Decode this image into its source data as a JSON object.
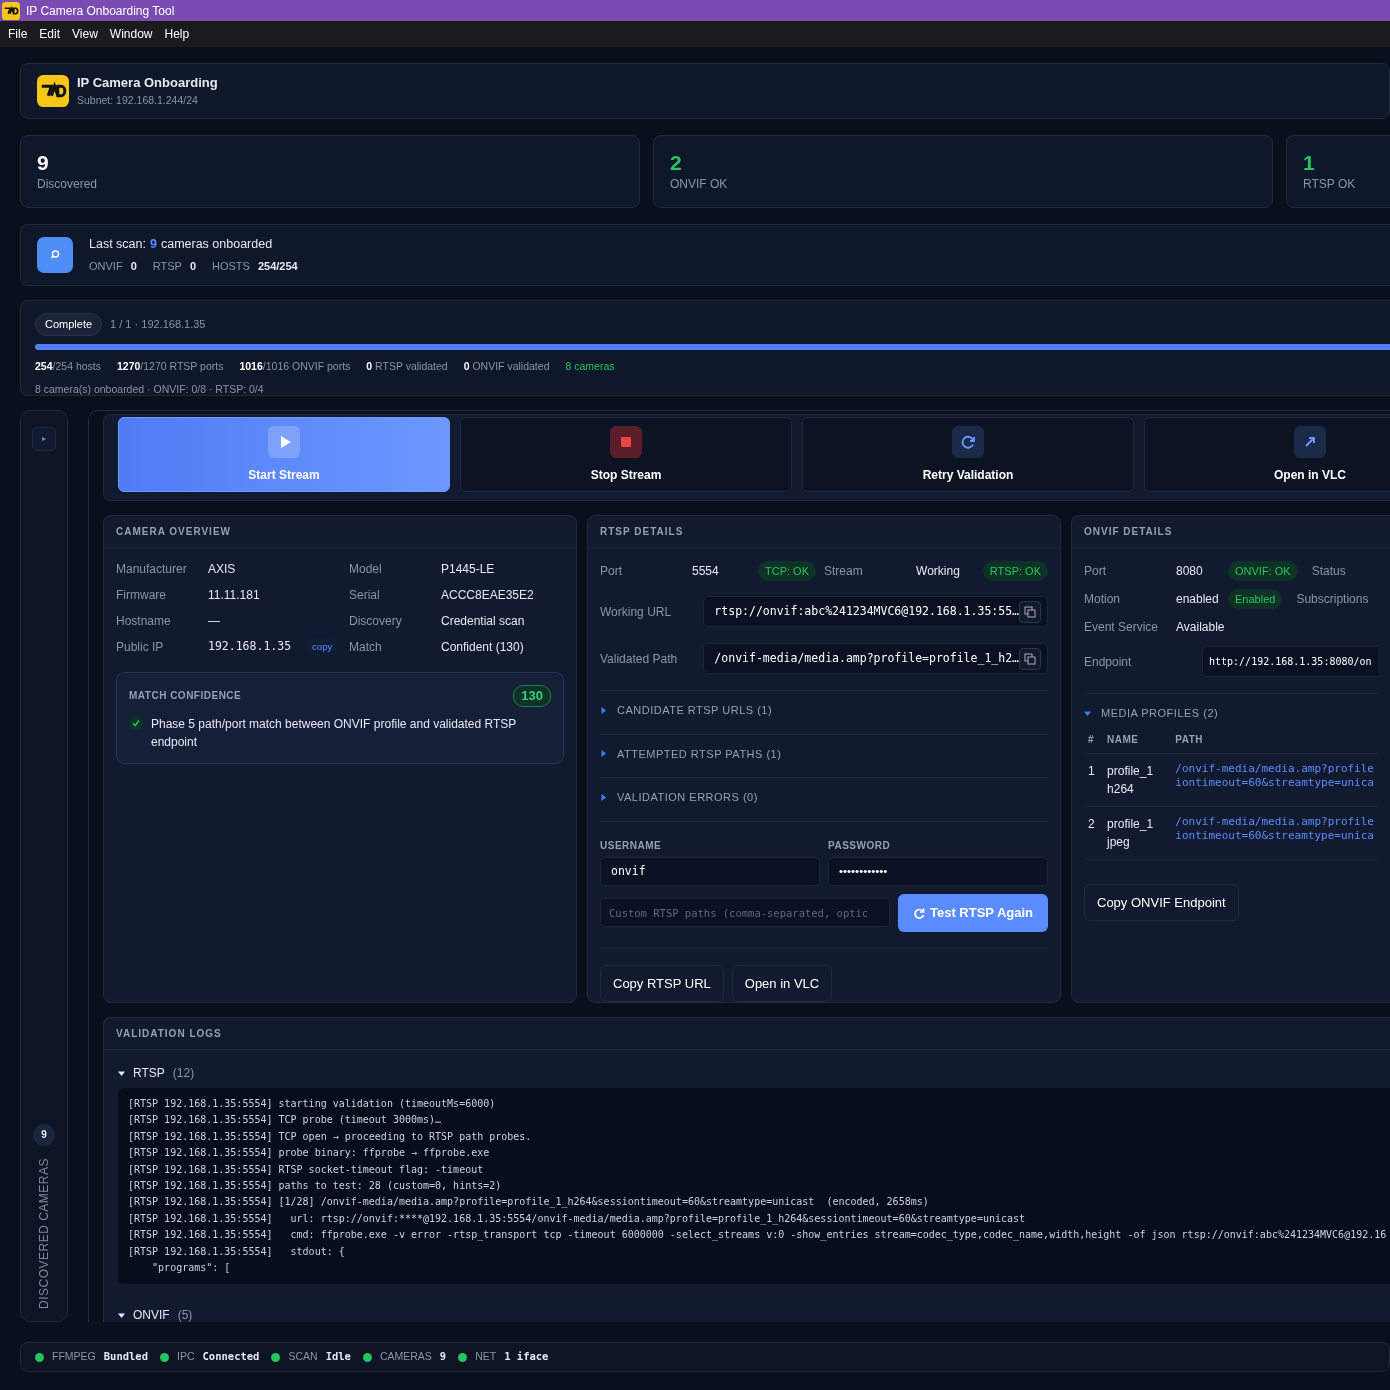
{
  "window": {
    "title": "IP Camera Onboarding Tool"
  },
  "menu": [
    "File",
    "Edit",
    "View",
    "Window",
    "Help"
  ],
  "header": {
    "title": "IP Camera Onboarding",
    "subtitle": "Subnet: 192.168.1.244/24"
  },
  "stats": [
    {
      "value": "9",
      "label": "Discovered",
      "color": "#ffffff"
    },
    {
      "value": "2",
      "label": "ONVIF OK",
      "color": "#22c55e"
    },
    {
      "value": "1",
      "label": "RTSP OK",
      "color": "#22c55e"
    }
  ],
  "last_scan": {
    "lead": "Last scan:",
    "count": "9",
    "tail": "cameras onboarded",
    "counters": [
      {
        "label": "ONVIF",
        "value": "0"
      },
      {
        "label": "RTSP",
        "value": "0"
      },
      {
        "label": "HOSTS",
        "value": "254/254"
      }
    ]
  },
  "progress": {
    "status": "Complete",
    "position": "1 / 1 · 192.168.1.35",
    "level": 1,
    "counts": [
      "**254**/254 hosts",
      "**1270**/1270 RTSP ports",
      "**1016**/1016 ONVIF ports",
      "**0** RTSP validated",
      "**0** ONVIF validated"
    ],
    "cameras": "8 cameras",
    "summary": "8 camera(s) onboarded · ONVIF: 0/8 · RTSP: 0/4"
  },
  "sidebar": {
    "toggle": "▸",
    "count": "9",
    "title": "DISCOVERED CAMERAS"
  },
  "actions": [
    {
      "label": "Start Stream",
      "kind": "play",
      "selected": true
    },
    {
      "label": "Stop Stream",
      "kind": "stop",
      "selected": false
    },
    {
      "label": "Retry Validation",
      "kind": "retry",
      "selected": false
    },
    {
      "label": "Open in VLC",
      "kind": "external",
      "selected": false
    }
  ],
  "camera_overview": {
    "title": "CAMERA OVERVIEW",
    "fields": [
      {
        "label": "Manufacturer",
        "value": "AXIS"
      },
      {
        "label": "Model",
        "value": "P1445-LE"
      },
      {
        "label": "Firmware",
        "value": "11.11.181"
      },
      {
        "label": "Serial",
        "value": "ACCC8EAE35E2"
      },
      {
        "label": "Hostname",
        "value": "—"
      },
      {
        "label": "Discovery",
        "value": "Credential scan"
      },
      {
        "label": "Public IP",
        "value": "192.168.1.35",
        "kind": "mono",
        "action": "copy"
      },
      {
        "label": "Match",
        "value": "Confident (130)"
      }
    ],
    "confidence": {
      "title": "MATCH CONFIDENCE",
      "score": "130",
      "reasons": [
        {
          "text": "Phase 5 path/port match between ONVIF profile and validated RTSP endpoint",
          "checked": true
        }
      ]
    }
  },
  "rtsp": {
    "title": "RTSP DETAILS",
    "port_label": "Port",
    "port": "5554",
    "tcp_badge": "TCP: OK",
    "stream_label": "Stream",
    "stream": "Working",
    "rtsp_badge": "RTSP: OK",
    "urls": [
      {
        "label": "Working URL",
        "value": "rtsp://onvif:abc%241234MVC6@192.168.1.35:55…"
      },
      {
        "label": "Validated Path",
        "value": "/onvif-media/media.amp?profile=profile_1_h2…"
      }
    ],
    "sections": [
      {
        "label": "CANDIDATE RTSP URLS (1)",
        "expanded": false
      },
      {
        "label": "ATTEMPTED RTSP PATHS (1)",
        "expanded": false
      },
      {
        "label": "VALIDATION ERRORS (0)",
        "expanded": false
      }
    ],
    "username": {
      "label": "USERNAME",
      "value": "onvif"
    },
    "password": {
      "label": "PASSWORD",
      "value": "••••••••••••"
    },
    "custom_paths": {
      "placeholder": "Custom RTSP paths (comma-separated, optic"
    },
    "test_button": "Test RTSP Again",
    "buttons": [
      "Copy RTSP URL",
      "Open in VLC"
    ]
  },
  "onvif": {
    "title": "ONVIF DETAILS",
    "rows": [
      {
        "cells": [
          {
            "label": "Port",
            "value": "8080",
            "badge": "ONVIF: OK"
          },
          {
            "label": "Status"
          }
        ]
      },
      {
        "cells": [
          {
            "label": "Motion",
            "value": "enabled",
            "badge": "Enabled"
          },
          {
            "label": "Subscriptions"
          }
        ]
      },
      {
        "cells": [
          {
            "label": "Event Service",
            "value": "Available"
          }
        ]
      }
    ],
    "endpoint": {
      "label": "Endpoint",
      "value": "http://192.168.1.35:8080/on"
    },
    "profiles": {
      "label": "MEDIA PROFILES (2)",
      "expanded": true,
      "columns": [
        "#",
        "NAME",
        "PATH"
      ],
      "rows": [
        {
          "index": "1",
          "name": "profile_1 h264",
          "path_lines": [
            "/onvif-media/media.amp?profile",
            "iontimeout=60&streamtype=unica"
          ]
        },
        {
          "index": "2",
          "name": "profile_1 jpeg",
          "path_lines": [
            "/onvif-media/media.amp?profile",
            "iontimeout=60&streamtype=unica"
          ]
        }
      ]
    },
    "copy_button": "Copy ONVIF Endpoint"
  },
  "logs": {
    "title": "VALIDATION LOGS",
    "groups": [
      {
        "label": "RTSP",
        "count": "(12)",
        "expanded": true,
        "lines": [
          "[RTSP 192.168.1.35:5554] starting validation (timeoutMs=6000)",
          "[RTSP 192.168.1.35:5554] TCP probe (timeout 3000ms)…",
          "[RTSP 192.168.1.35:5554] TCP open → proceeding to RTSP path probes.",
          "[RTSP 192.168.1.35:5554] probe binary: ffprobe → ffprobe.exe",
          "[RTSP 192.168.1.35:5554] RTSP socket-timeout flag: -timeout",
          "[RTSP 192.168.1.35:5554] paths to test: 28 (custom=0, hints=2)",
          "[RTSP 192.168.1.35:5554] [1/28] /onvif-media/media.amp?profile=profile_1_h264&sessiontimeout=60&streamtype=unicast  (encoded, 2658ms)",
          "[RTSP 192.168.1.35:5554]   url: rtsp://onvif:****@192.168.1.35:5554/onvif-media/media.amp?profile=profile_1_h264&sessiontimeout=60&streamtype=unicast",
          "[RTSP 192.168.1.35:5554]   cmd: ffprobe.exe -v error -rtsp_transport tcp -timeout 6000000 -select_streams v:0 -show_entries stream=codec_type,codec_name,width,height -of json rtsp://onvif:abc%241234MVC6@192.16",
          "[RTSP 192.168.1.35:5554]   stdout: {",
          "    \"programs\": ["
        ]
      },
      {
        "label": "ONVIF",
        "count": "(5)",
        "expanded": true
      }
    ]
  },
  "status_bar": [
    {
      "label": "FFMPEG",
      "value": "Bundled"
    },
    {
      "label": "IPC",
      "value": "Connected"
    },
    {
      "label": "SCAN",
      "value": "Idle"
    },
    {
      "label": "CAMERAS",
      "value": "9"
    },
    {
      "label": "NET",
      "value": "1 iface"
    }
  ]
}
